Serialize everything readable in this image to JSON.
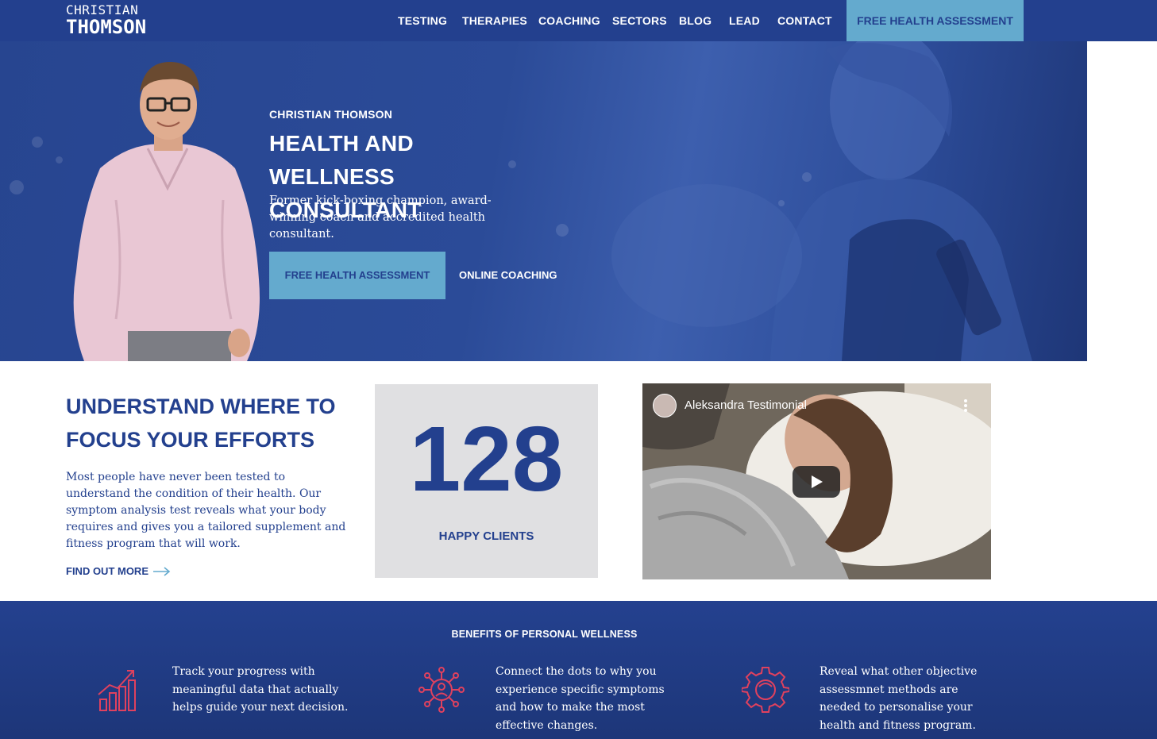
{
  "header": {
    "logo_line1": "CHRISTIAN",
    "logo_line2": "THOMSON",
    "nav": [
      "TESTING",
      "THERAPIES",
      "COACHING",
      "SECTORS",
      "BLOG",
      "LEAD",
      "CONTACT"
    ],
    "cta": "FREE HEALTH ASSESSMENT"
  },
  "hero": {
    "eyebrow": "CHRISTIAN THOMSON",
    "title": "HEALTH AND WELLNESS CONSULTANT",
    "subtitle": "Former kick-boxing champion, award-winning coach and accredited health consultant.",
    "primary_button": "FREE HEALTH ASSESSMENT",
    "secondary_button": "ONLINE COACHING"
  },
  "focus": {
    "title": "UNDERSTAND WHERE TO FOCUS YOUR EFFORTS",
    "text": "Most people have never been tested to understand the condition of their health. Our symptom analysis test reveals what your body requires and gives you a tailored supplement and fitness program that will work.",
    "link": "FIND OUT MORE"
  },
  "stat": {
    "number": "128",
    "label": "HAPPY CLIENTS"
  },
  "video": {
    "title": "Aleksandra Testimonial"
  },
  "benefits": {
    "title": "BENEFITS OF PERSONAL WELLNESS",
    "items": [
      {
        "icon": "chart-growth-icon",
        "text": "Track your progress with meaningful data that actually helps guide your next decision."
      },
      {
        "icon": "virus-network-icon",
        "text": "Connect the dots to why you experience specific symptoms and how to make the most effective changes."
      },
      {
        "icon": "gear-icon",
        "text": "Reveal what other objective assessmnet methods are needed to personalise your health and fitness program."
      }
    ]
  },
  "colors": {
    "brand_blue": "#23408e",
    "accent_light_blue": "#64aace",
    "icon_red": "#e0415e",
    "stat_box": "#e0e0e2"
  }
}
